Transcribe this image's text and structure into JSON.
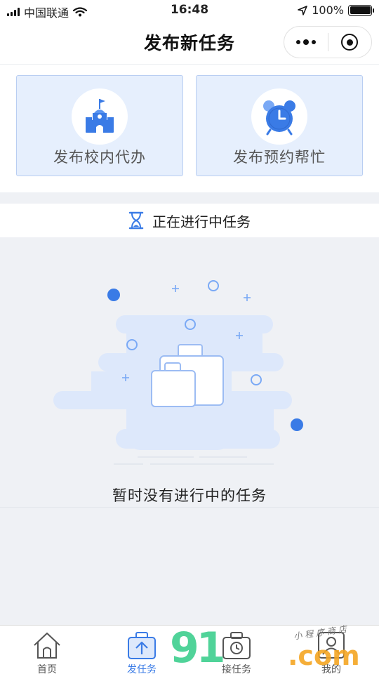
{
  "status_bar": {
    "carrier": "中国联通",
    "time": "16:48",
    "battery": "100%",
    "battery_level": 1.0
  },
  "nav": {
    "title": "发布新任务"
  },
  "actions": [
    {
      "label": "发布校内代办",
      "icon": "school-icon"
    },
    {
      "label": "发布预约帮忙",
      "icon": "alarm-clock-icon"
    }
  ],
  "section": {
    "icon": "hourglass-icon",
    "title": "正在进行中任务"
  },
  "empty_state": {
    "icon": "luggage-illustration",
    "text": "暂时没有进行中的任务"
  },
  "tabbar": {
    "active_index": 1,
    "items": [
      {
        "label": "首页",
        "icon": "home-icon"
      },
      {
        "label": "发任务",
        "icon": "upload-bag-icon"
      },
      {
        "label": "接任务",
        "icon": "briefcase-clock-icon"
      },
      {
        "label": "我的",
        "icon": "profile-icon"
      }
    ]
  },
  "watermark": {
    "main": "91",
    "suffix": ".com",
    "small": "小程序商店"
  },
  "colors": {
    "accent": "#3a7be6",
    "card_bg": "#e6effd",
    "card_border": "#b9cef2",
    "page_bg": "#eff1f5"
  }
}
